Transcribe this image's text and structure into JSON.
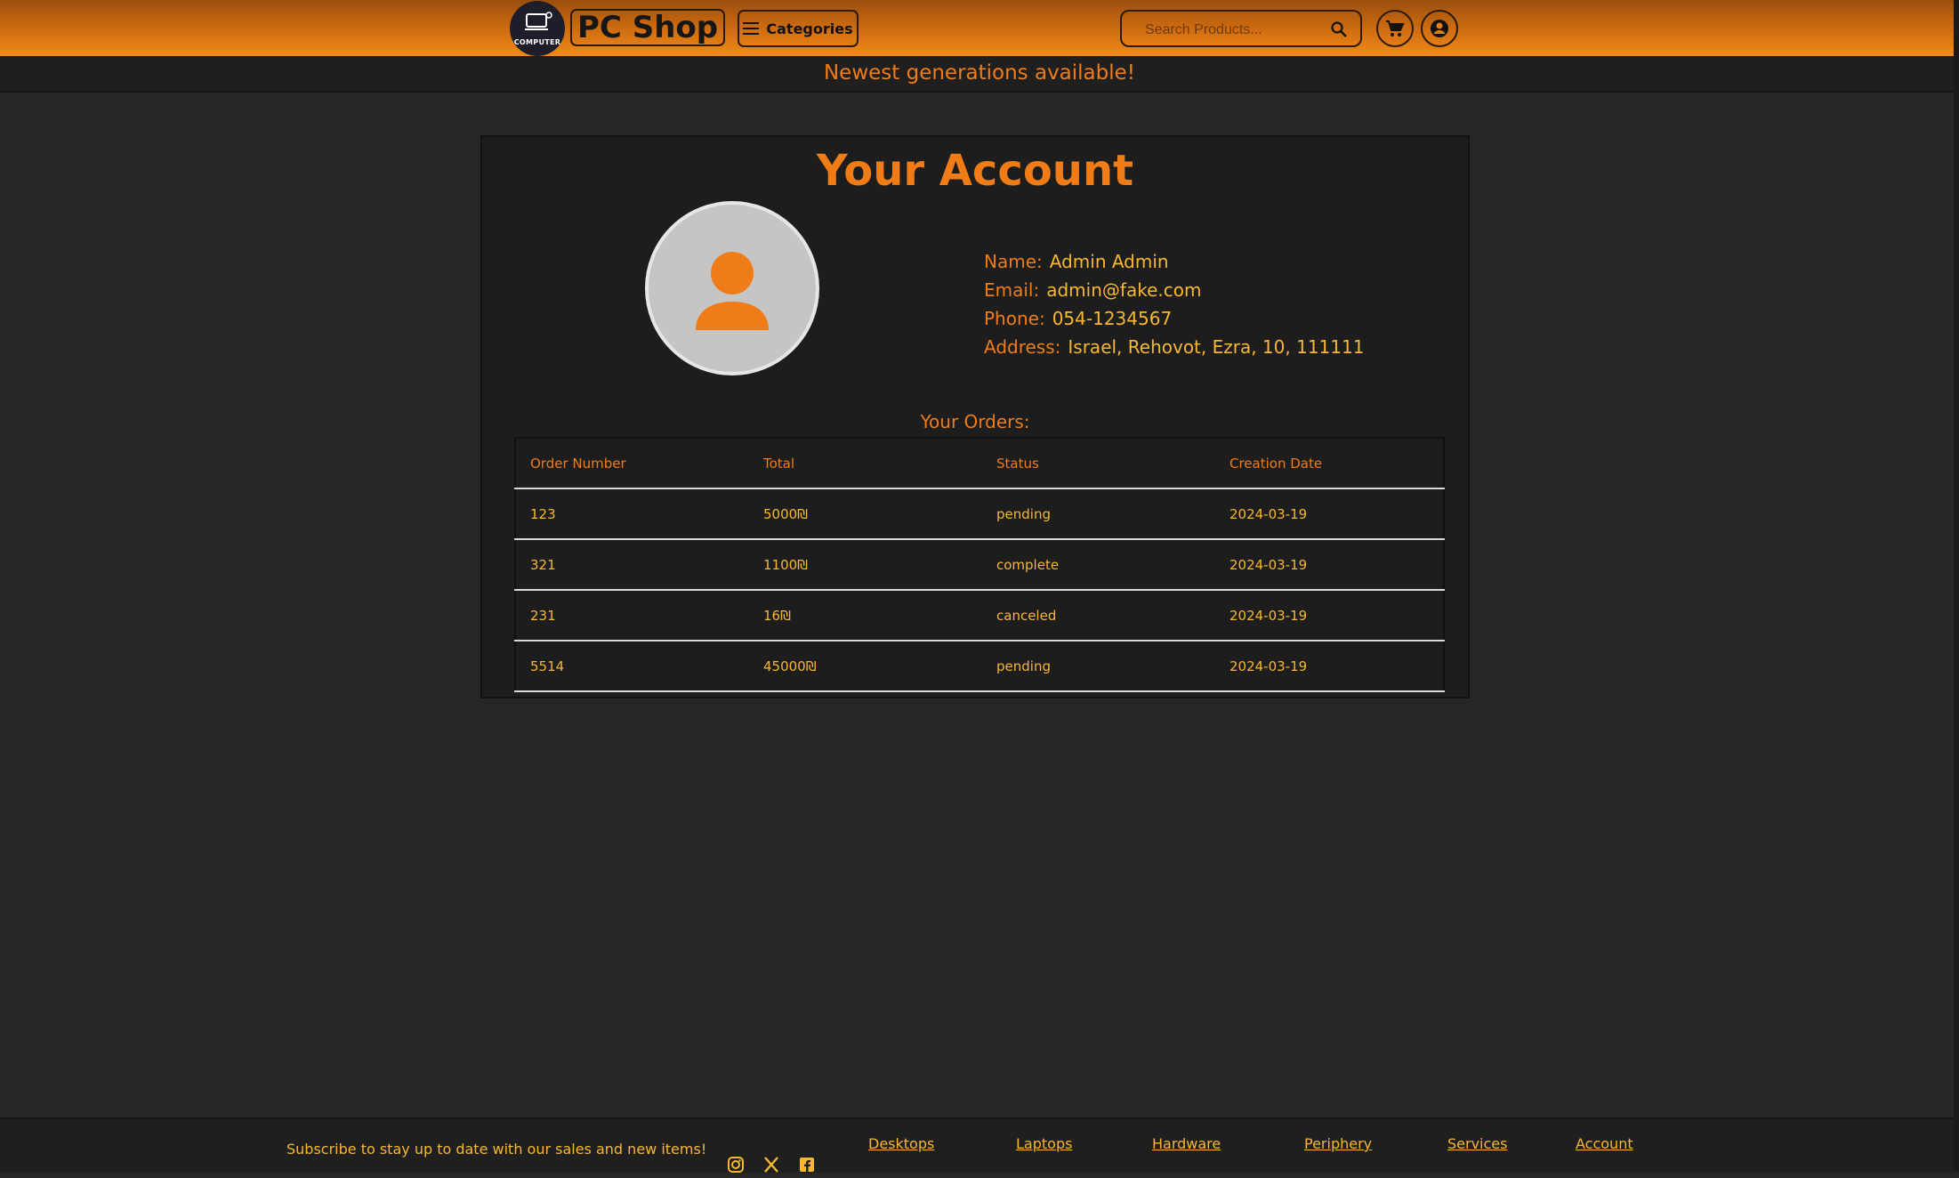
{
  "header": {
    "logo_text": "COMPUTER",
    "brand": "PC Shop",
    "categories_label": "Categories",
    "search_placeholder": "Search Products..."
  },
  "promo": "Newest generations available!",
  "account": {
    "title": "Your Account",
    "fields": [
      {
        "label": "Name:",
        "value": "Admin Admin"
      },
      {
        "label": "Email:",
        "value": "admin@fake.com"
      },
      {
        "label": "Phone:",
        "value": "054-1234567"
      },
      {
        "label": "Address:",
        "value": "Israel, Rehovot, Ezra, 10, 111111"
      }
    ]
  },
  "orders": {
    "label": "Your Orders:",
    "columns": [
      "Order Number",
      "Total",
      "Status",
      "Creation Date"
    ],
    "rows": [
      [
        "123",
        "5000₪",
        "pending",
        "2024-03-19"
      ],
      [
        "321",
        "1100₪",
        "complete",
        "2024-03-19"
      ],
      [
        "231",
        "16₪",
        "canceled",
        "2024-03-19"
      ],
      [
        "5514",
        "45000₪",
        "pending",
        "2024-03-19"
      ]
    ]
  },
  "footer": {
    "subscribe": "Subscribe to stay up to date with our sales and new items!",
    "socials": [
      "instagram-icon",
      "x-icon",
      "facebook-icon"
    ],
    "links": [
      "Desktops",
      "Laptops",
      "Hardware",
      "Periphery",
      "Services",
      "Account"
    ]
  },
  "colors": {
    "accent": "#f07c17",
    "value": "#f7b731",
    "background": "#262626"
  }
}
